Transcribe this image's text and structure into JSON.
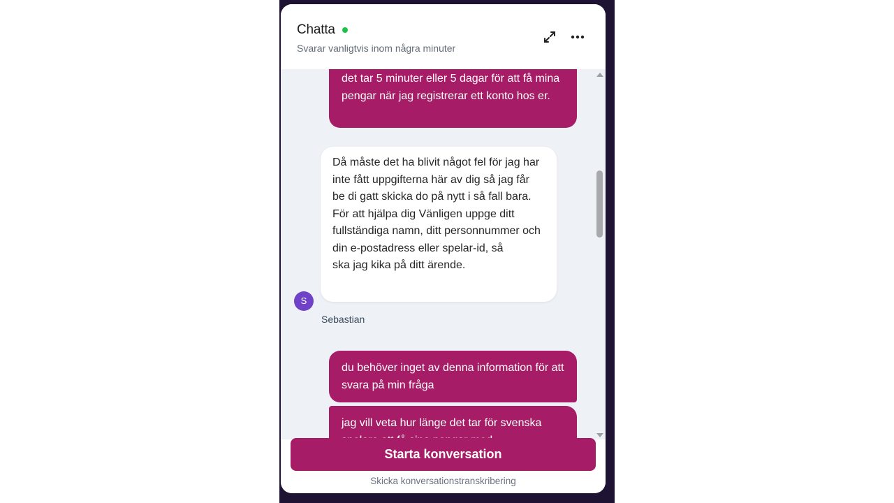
{
  "header": {
    "title": "Chatta",
    "status_color": "#1ec24b",
    "subtitle": "Svarar vanligtvis inom några minuter",
    "expand_icon": "expand-icon",
    "more_icon": "more-horizontal-icon"
  },
  "messages": [
    {
      "from": "user",
      "text": "det tar 5 minuter eller 5 dagar för att få mina pengar när jag registrerar ett konto hos er."
    },
    {
      "from": "agent",
      "text": "Då måste det ha blivit något fel för jag har inte fått uppgifterna här av dig så jag får be di gatt skicka do på nytt i så fall bara. För att hjälpa dig Vänligen uppge ditt fullständiga namn, ditt personnummer och din e-postadress eller spelar-id, så\nska jag kika på ditt ärende.",
      "avatar_letter": "S",
      "sender": "Sebastian"
    },
    {
      "from": "user",
      "text": "du behöver inget av denna information för att svara på min fråga"
    },
    {
      "from": "user",
      "text": "jag vill veta hur länge det tar för svenska spelare att få sina pengar med"
    }
  ],
  "footer": {
    "start_button": "Starta konversation",
    "transcript_link": "Skicka konversationstranskribering"
  },
  "colors": {
    "brand": "#a61c66",
    "avatar": "#6f42c8",
    "chat_background": "#eef1f5"
  }
}
